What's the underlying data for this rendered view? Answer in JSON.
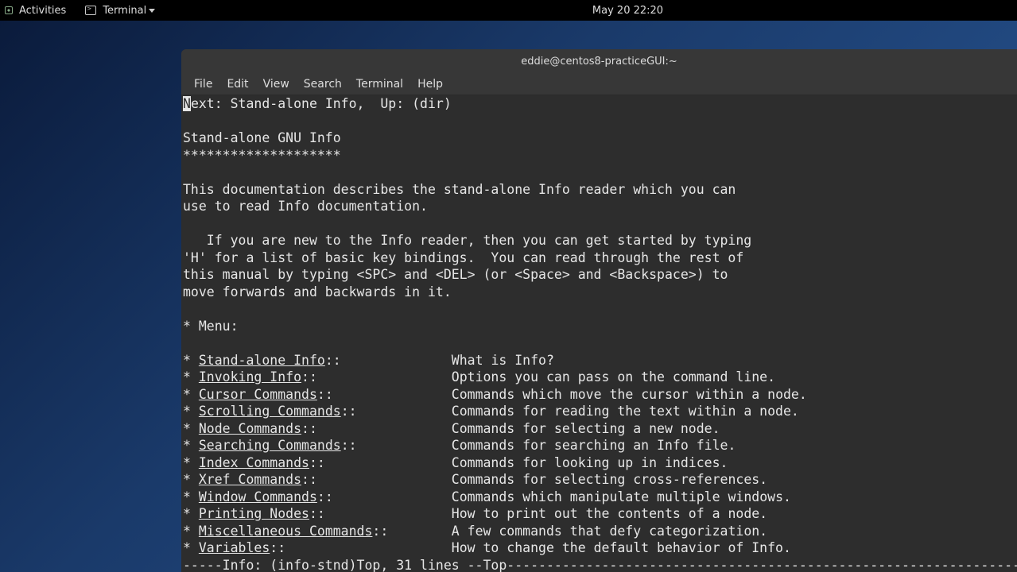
{
  "topbar": {
    "activities": "Activities",
    "terminal": "Terminal",
    "datetime": "May 20  22:20"
  },
  "window": {
    "title": "eddie@centos8-practiceGUI:~",
    "menus": {
      "file": "File",
      "edit": "Edit",
      "view": "View",
      "search": "Search",
      "terminal": "Terminal",
      "help": "Help"
    }
  },
  "info": {
    "nav": "ext: Stand-alone Info,  Up: (dir)",
    "nav_first": "N",
    "title": "Stand-alone GNU Info",
    "stars": "********************",
    "para1_l1": "This documentation describes the stand-alone Info reader which you can",
    "para1_l2": "use to read Info documentation.",
    "para2_l1": "   If you are new to the Info reader, then you can get started by typing",
    "para2_l2": "'H' for a list of basic key bindings.  You can read through the rest of",
    "para2_l3": "this manual by typing <SPC> and <DEL> (or <Space> and <Backspace>) to",
    "para2_l4": "move forwards and backwards in it.",
    "menu_hdr": "* Menu:",
    "menu": [
      {
        "link": "Stand-alone Info",
        "sep": "::              ",
        "desc": "What is Info?"
      },
      {
        "link": "Invoking Info",
        "sep": "::                 ",
        "desc": "Options you can pass on the command line."
      },
      {
        "link": "Cursor Commands",
        "sep": "::               ",
        "desc": "Commands which move the cursor within a node."
      },
      {
        "link": "Scrolling Commands",
        "sep": "::            ",
        "desc": "Commands for reading the text within a node."
      },
      {
        "link": "Node Commands",
        "sep": "::                 ",
        "desc": "Commands for selecting a new node."
      },
      {
        "link": "Searching Commands",
        "sep": "::            ",
        "desc": "Commands for searching an Info file."
      },
      {
        "link": "Index Commands",
        "sep": "::                ",
        "desc": "Commands for looking up in indices."
      },
      {
        "link": "Xref Commands",
        "sep": "::                 ",
        "desc": "Commands for selecting cross-references."
      },
      {
        "link": "Window Commands",
        "sep": "::               ",
        "desc": "Commands which manipulate multiple windows."
      },
      {
        "link": "Printing Nodes",
        "sep": "::                ",
        "desc": "How to print out the contents of a node."
      },
      {
        "link": "Miscellaneous Commands",
        "sep": "::        ",
        "desc": "A few commands that defy categorization."
      },
      {
        "link": "Variables",
        "sep": "::                     ",
        "desc": "How to change the default behavior of Info."
      }
    ],
    "status_prefix": "-----",
    "status_main": "Info: (info-stnd)Top, 31 lines --Top",
    "status_dashes": "-----------------------------------------------------------------"
  }
}
